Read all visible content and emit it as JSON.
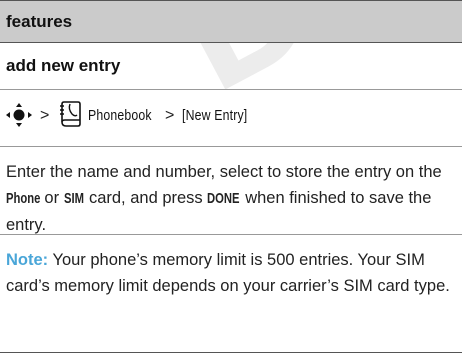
{
  "header": {
    "title": "features"
  },
  "section": {
    "title": "add new entry"
  },
  "path": {
    "separator": ">",
    "item1": "Phonebook",
    "separator2": ">",
    "item2": "[New Entry]"
  },
  "body": {
    "text1": "Enter the name and number, select to store the entry on the ",
    "key_phone": "Phone",
    "text2": " or ",
    "key_sim": "SIM",
    "text3": " card, and press ",
    "key_done": "DONE",
    "text4": " when finished to save the entry."
  },
  "note": {
    "label": "Note:",
    "text": " Your phone’s memory limit is 500 entries. Your SIM card’s memory limit depends on your carrier’s SIM card type."
  },
  "watermark": {
    "text": "DRAFT",
    "color": "#e9e9e9"
  },
  "colors": {
    "header_bg": "#cbcbcb",
    "note_accent": "#4aa6d8"
  }
}
